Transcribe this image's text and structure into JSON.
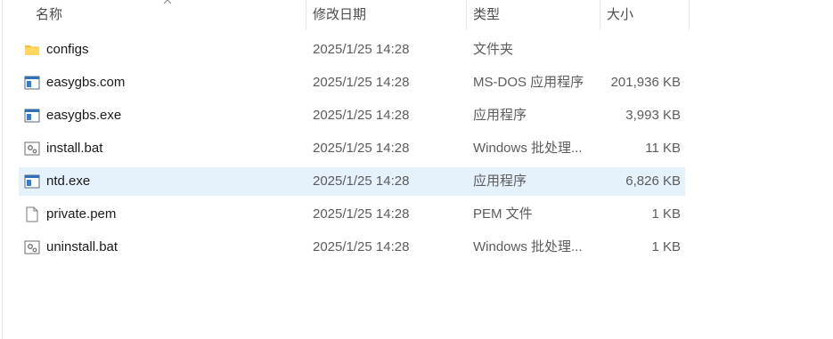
{
  "columns": {
    "name": "名称",
    "date": "修改日期",
    "type": "类型",
    "size": "大小"
  },
  "files": [
    {
      "name": "configs",
      "date": "2025/1/25 14:28",
      "type": "文件夹",
      "size": "",
      "icon": "folder-icon",
      "selected": false
    },
    {
      "name": "easygbs.com",
      "date": "2025/1/25 14:28",
      "type": "MS-DOS 应用程序",
      "size": "201,936 KB",
      "icon": "application-icon",
      "selected": false
    },
    {
      "name": "easygbs.exe",
      "date": "2025/1/25 14:28",
      "type": "应用程序",
      "size": "3,993 KB",
      "icon": "application-icon",
      "selected": false
    },
    {
      "name": "install.bat",
      "date": "2025/1/25 14:28",
      "type": "Windows 批处理...",
      "size": "11 KB",
      "icon": "batch-file-icon",
      "selected": false
    },
    {
      "name": "ntd.exe",
      "date": "2025/1/25 14:28",
      "type": "应用程序",
      "size": "6,826 KB",
      "icon": "application-icon",
      "selected": true
    },
    {
      "name": "private.pem",
      "date": "2025/1/25 14:28",
      "type": "PEM 文件",
      "size": "1 KB",
      "icon": "document-icon",
      "selected": false
    },
    {
      "name": "uninstall.bat",
      "date": "2025/1/25 14:28",
      "type": "Windows 批处理...",
      "size": "1 KB",
      "icon": "batch-file-icon",
      "selected": false
    }
  ]
}
